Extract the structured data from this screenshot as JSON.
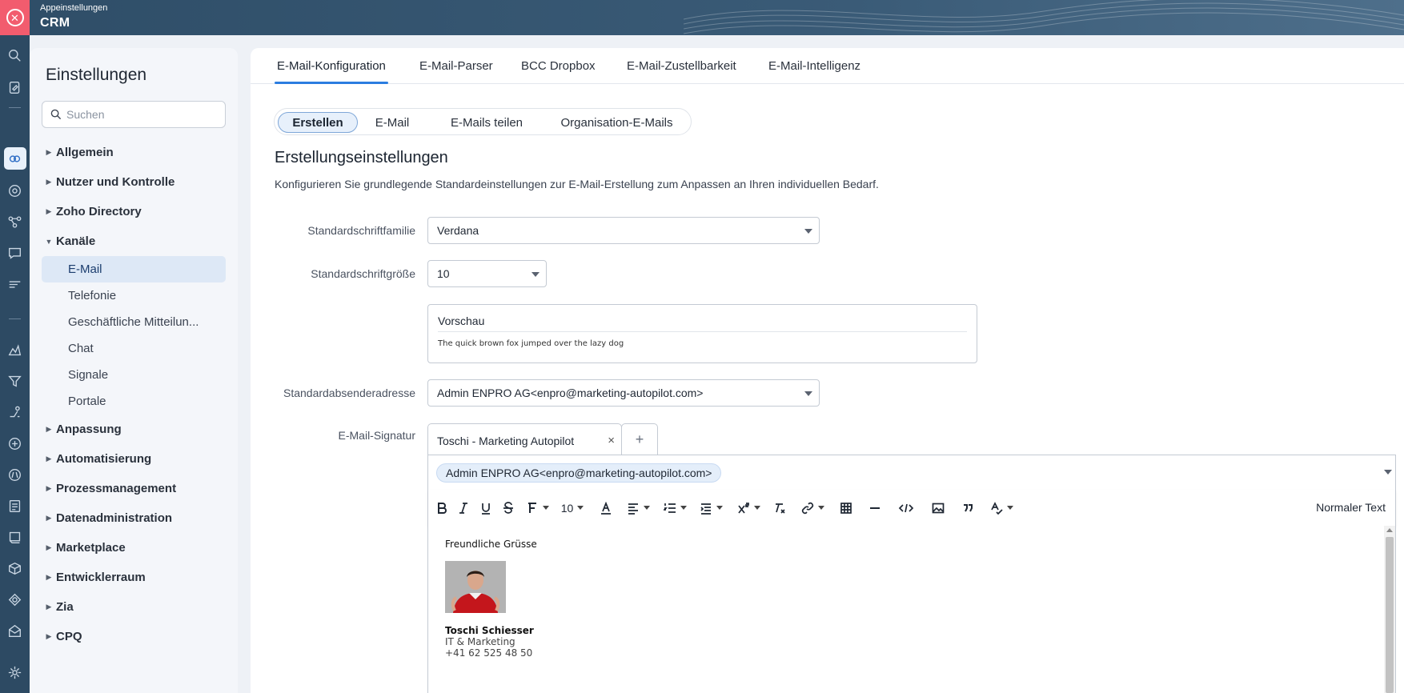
{
  "header": {
    "subtitle": "Appeinstellungen",
    "title": "CRM"
  },
  "rail": {
    "icons": [
      "search-icon",
      "notes-icon",
      "channels-icon",
      "email-at-icon",
      "workflow-icon",
      "chat-icon",
      "signal-icon",
      "analytics-icon",
      "funnel-icon",
      "journey-icon",
      "apps-icon",
      "code-icon",
      "forms-icon",
      "portal-icon",
      "cube-icon",
      "target-icon",
      "inbox-icon",
      "settings-icon"
    ]
  },
  "sidebar": {
    "title": "Einstellungen",
    "search_placeholder": "Suchen",
    "items": [
      {
        "label": "Allgemein"
      },
      {
        "label": "Nutzer und Kontrolle"
      },
      {
        "label": "Zoho Directory"
      },
      {
        "label": "Kanäle",
        "children": [
          "E-Mail",
          "Telefonie",
          "Geschäftliche Mitteilun...",
          "Chat",
          "Signale",
          "Portale"
        ]
      },
      {
        "label": "Anpassung"
      },
      {
        "label": "Automatisierung"
      },
      {
        "label": "Prozessmanagement"
      },
      {
        "label": "Datenadministration"
      },
      {
        "label": "Marketplace"
      },
      {
        "label": "Entwicklerraum"
      },
      {
        "label": "Zia"
      },
      {
        "label": "CPQ"
      }
    ]
  },
  "tabs": [
    "E-Mail-Konfiguration",
    "E-Mail-Parser",
    "BCC Dropbox",
    "E-Mail-Zustellbarkeit",
    "E-Mail-Intelligenz"
  ],
  "pills": [
    "Erstellen",
    "E-Mail",
    "E-Mails teilen",
    "Organisation-E-Mails"
  ],
  "section": {
    "title": "Erstellungseinstellungen",
    "description": "Konfigurieren Sie grundlegende Standardeinstellungen zur E-Mail-Erstellung zum Anpassen an Ihren individuellen Bedarf."
  },
  "form": {
    "font_family_label": "Standardschriftfamilie",
    "font_family_value": "Verdana",
    "font_size_label": "Standardschriftgröße",
    "font_size_value": "10",
    "preview_title": "Vorschau",
    "preview_sample": "The quick brown fox jumped over the lazy dog",
    "sender_label": "Standardabsenderadresse",
    "sender_value": "Admin ENPRO AG<enpro@marketing-autopilot.com>",
    "signature_label": "E-Mail-Signatur",
    "signature_tab": "Toschi - Marketing Autopilot",
    "signature_add": "+",
    "signature_close": "×",
    "signature_from": "Admin ENPRO AG<enpro@marketing-autopilot.com>"
  },
  "editor_toolbar": {
    "font_size": "10",
    "block_style": "Normaler Text"
  },
  "signature_body": {
    "greeting": "Freundliche Grüsse",
    "name": "Toschi Schiesser",
    "role": "IT & Marketing",
    "phone": "+41 62 525 48 50"
  }
}
